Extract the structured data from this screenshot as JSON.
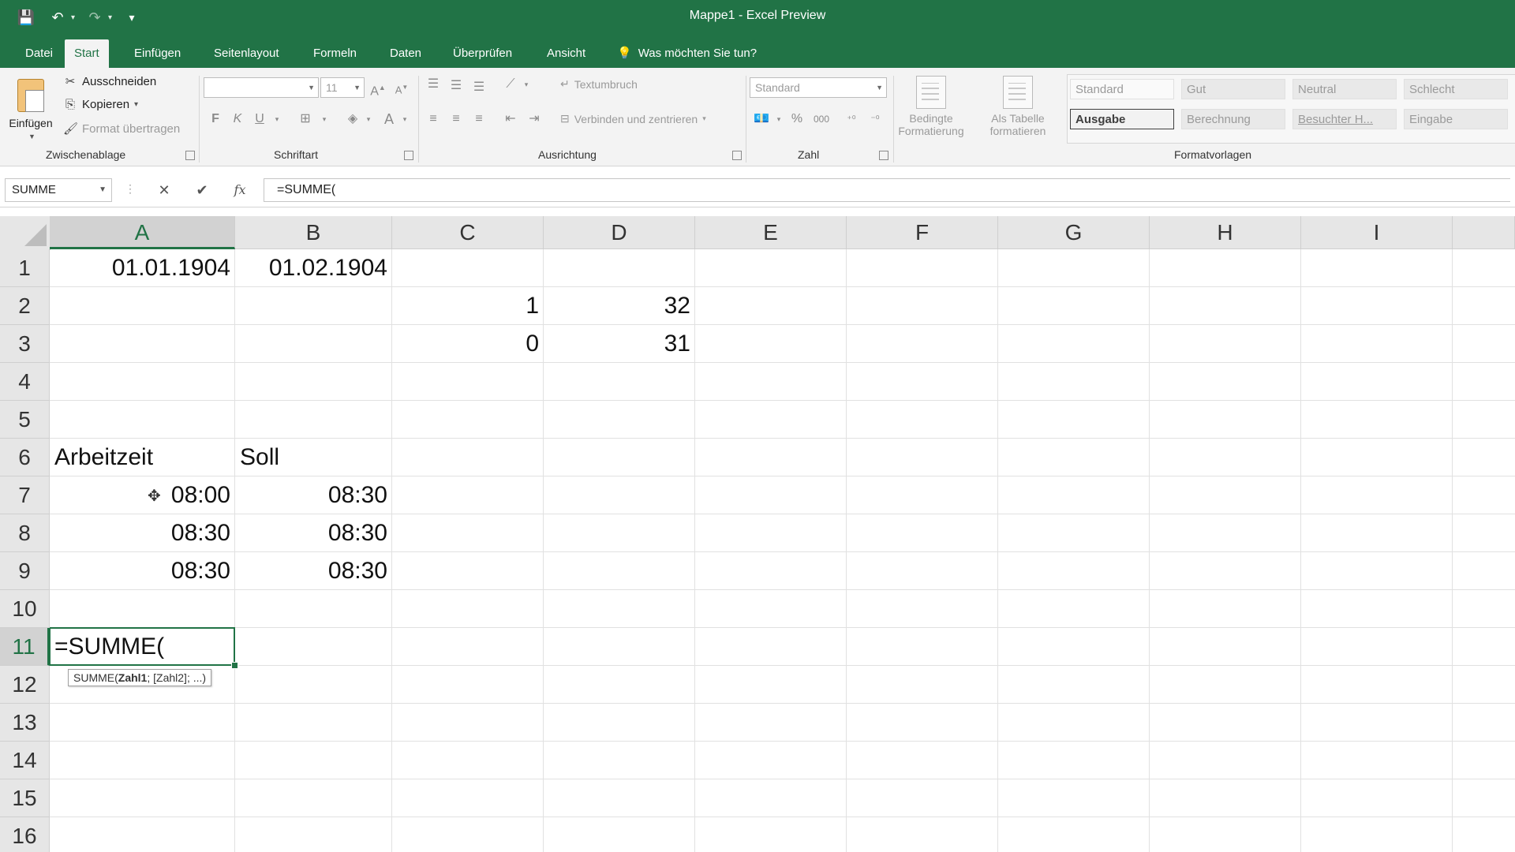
{
  "window": {
    "title": "Mappe1  -  Excel Preview"
  },
  "qat": {
    "save": "💾",
    "undo": "↶",
    "redo": "↷",
    "more": "▾"
  },
  "tabs": [
    {
      "label": "Datei",
      "active": false
    },
    {
      "label": "Start",
      "active": true
    },
    {
      "label": "Einfügen",
      "active": false
    },
    {
      "label": "Seitenlayout",
      "active": false
    },
    {
      "label": "Formeln",
      "active": false
    },
    {
      "label": "Daten",
      "active": false
    },
    {
      "label": "Überprüfen",
      "active": false
    },
    {
      "label": "Ansicht",
      "active": false
    }
  ],
  "tellme": {
    "label": "Was möchten Sie tun?"
  },
  "ribbon": {
    "clipboard": {
      "paste": "Einfügen",
      "cut": "Ausschneiden",
      "copy": "Kopieren",
      "format_painter": "Format übertragen",
      "group": "Zwischenablage"
    },
    "font": {
      "name": "",
      "size": "11",
      "bold": "F",
      "italic": "K",
      "underline": "U",
      "font_color": "A",
      "group": "Schriftart"
    },
    "alignment": {
      "wrap": "Textumbruch",
      "merge": "Verbinden und zentrieren",
      "group": "Ausrichtung"
    },
    "number": {
      "format": "Standard",
      "percent": "%",
      "thousands": "000",
      "group": "Zahl"
    },
    "styles": {
      "conditional": "Bedingte Formatierung",
      "as_table": "Als Tabelle formatieren",
      "cells": [
        [
          "Standard",
          "Gut",
          "Neutral",
          "Schlecht"
        ],
        [
          "Ausgabe",
          "Berechnung",
          "Besuchter H...",
          "Eingabe"
        ]
      ],
      "group": "Formatvorlagen"
    }
  },
  "formula_bar": {
    "name_box": "SUMME",
    "cancel": "✕",
    "enter": "✔",
    "fx": "fx",
    "formula": "=SUMME("
  },
  "sheet": {
    "columns": [
      "A",
      "B",
      "C",
      "D",
      "E",
      "F",
      "G",
      "H",
      "I"
    ],
    "rows": [
      "1",
      "2",
      "3",
      "4",
      "5",
      "6",
      "7",
      "8",
      "9",
      "10",
      "11",
      "12",
      "13",
      "14",
      "15",
      "16"
    ],
    "selected_column": "A",
    "selected_row": "11",
    "cells": {
      "A1": "01.01.1904",
      "B1": "01.02.1904",
      "C2": "1",
      "D2": "32",
      "C3": "0",
      "D3": "31",
      "A6": "Arbeitzeit",
      "B6": "Soll",
      "A7": "08:00",
      "B7": "08:30",
      "A8": "08:30",
      "B8": "08:30",
      "A9": "08:30",
      "B9": "08:30",
      "A11": "=SUMME("
    },
    "tooltip": "SUMME(Zahl1; [Zahl2]; ...)"
  },
  "colors": {
    "accent": "#217346",
    "ribbon_bg": "#f3f3f3",
    "header_bg": "#e6e6e6"
  }
}
